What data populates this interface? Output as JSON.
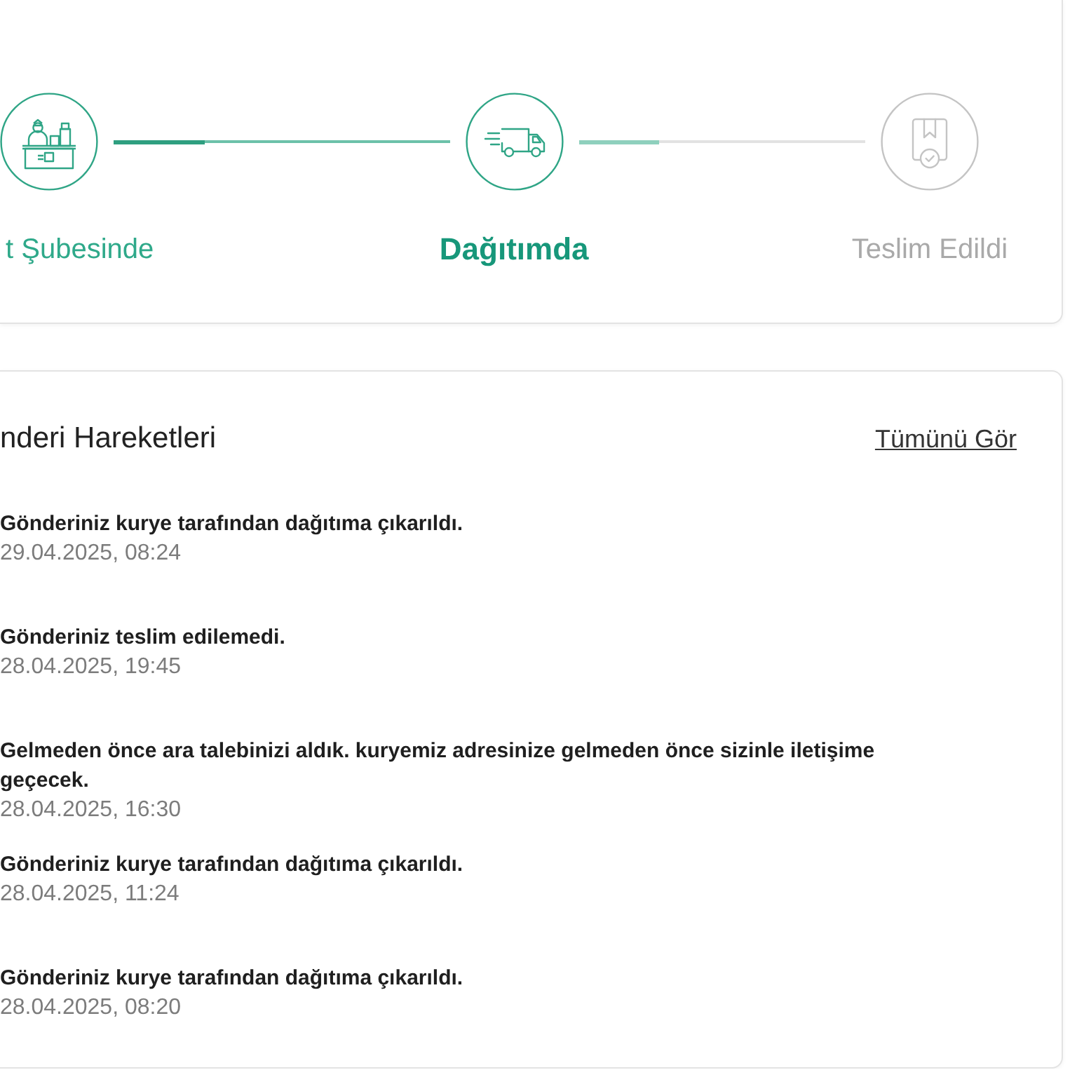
{
  "tracking_steps": {
    "steps": [
      {
        "label": "t Şubesinde",
        "reached": true,
        "selected": false
      },
      {
        "label": "Dağıtımda",
        "reached": true,
        "selected": true
      },
      {
        "label": "Teslim Edildi",
        "reached": false,
        "selected": false
      }
    ],
    "connectors": [
      {
        "level": 0.27
      },
      {
        "level": 0.28
      }
    ]
  },
  "shipment_movements": {
    "title": "nderi Hareketleri",
    "view_all_link": "Tümünü Gör",
    "events": [
      {
        "description": "Gönderiniz kurye tarafından dağıtıma çıkarıldı.",
        "timestamp": "29.04.2025, 08:24"
      },
      {
        "description": "Gönderiniz teslim edilemedi.",
        "timestamp": "28.04.2025, 19:45"
      },
      {
        "description": "Gelmeden önce ara talebinizi aldık. kuryemiz adresinize gelmeden önce sizinle iletişime geçecek.",
        "timestamp": "28.04.2025, 16:30"
      },
      {
        "description": "Gönderiniz kurye tarafından dağıtıma çıkarıldı.",
        "timestamp": "28.04.2025, 11:24"
      },
      {
        "description": "Gönderiniz kurye tarafından dağıtıma çıkarıldı.",
        "timestamp": "28.04.2025, 08:20"
      }
    ]
  }
}
